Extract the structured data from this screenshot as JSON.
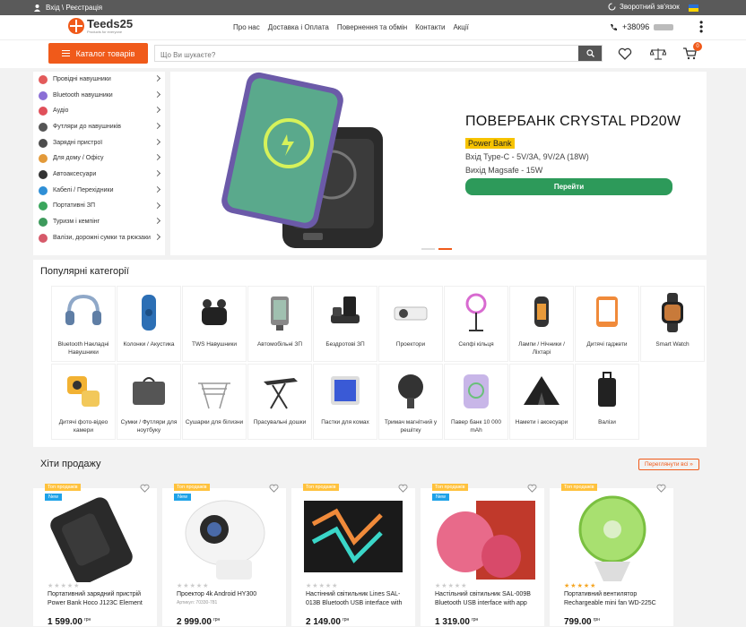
{
  "topbar": {
    "login": "Вхід \\ Реєстрація",
    "callback": "Зворотний зв'язок"
  },
  "header": {
    "logo": "Teeds25",
    "logo_sub": "Products for everyone",
    "nav": [
      "Про нас",
      "Доставка і Оплата",
      "Повернення та обмін",
      "Контакти",
      "Акції"
    ],
    "phone": "+38096"
  },
  "search": {
    "catalog_label": "Каталог товарів",
    "placeholder": "Що Ви шукаєте?",
    "cart_count": "0"
  },
  "sidebar": {
    "items": [
      {
        "label": "Провідні навушники",
        "color": "#e35b5b"
      },
      {
        "label": "Bluetooth навушники",
        "color": "#8b6fd6"
      },
      {
        "label": "Аудіо",
        "color": "#e0505a"
      },
      {
        "label": "Футляри до навушників",
        "color": "#555555"
      },
      {
        "label": "Зарядні пристрої",
        "color": "#4d4d4d"
      },
      {
        "label": "Для дому / Офісу",
        "color": "#e39a3a"
      },
      {
        "label": "Автоаксесуари",
        "color": "#333333"
      },
      {
        "label": "Кабелі / Перехідники",
        "color": "#2f8fd6"
      },
      {
        "label": "Портативні ЗП",
        "color": "#3aa65c"
      },
      {
        "label": "Туризм і кемпінг",
        "color": "#3d9a5c"
      },
      {
        "label": "Валізи, дорожні сумки та рюкзаки",
        "color": "#d65a6a"
      }
    ]
  },
  "banner": {
    "title": "ПОВЕРБАНК CRYSTAL PD20W",
    "tag": "Power Bank",
    "line1": "Вхід Type-C - 5V/3A, 9V/2A (18W)",
    "line2": "Вихід Magsafe - 15W",
    "button": "Перейти"
  },
  "categories": {
    "title": "Популярні категорії",
    "items": [
      {
        "label": "Bluetooth Накладні Навушники",
        "icon": "headphones-icon"
      },
      {
        "label": "Колонки / Акустика",
        "icon": "speaker-icon"
      },
      {
        "label": "TWS Навушники",
        "icon": "earbuds-icon"
      },
      {
        "label": "Автомобільні ЗП",
        "icon": "car-charger-icon"
      },
      {
        "label": "Бездротові ЗП",
        "icon": "wireless-charger-icon"
      },
      {
        "label": "Проектори",
        "icon": "projector-icon"
      },
      {
        "label": "Селфі кільця",
        "icon": "ring-light-icon"
      },
      {
        "label": "Лампи / Нічники / Ліхтарі",
        "icon": "lamp-icon"
      },
      {
        "label": "Дитячі гаджети",
        "icon": "kids-gadget-icon"
      },
      {
        "label": "Smart Watch",
        "icon": "watch-icon"
      },
      {
        "label": "Дитячі фото-відео камери",
        "icon": "kids-camera-icon"
      },
      {
        "label": "Сумки / Футляри для ноутбуку",
        "icon": "laptop-bag-icon"
      },
      {
        "label": "Сушарки для білизни",
        "icon": "dryer-rack-icon"
      },
      {
        "label": "Прасувальні дошки",
        "icon": "ironing-board-icon"
      },
      {
        "label": "Пастки для комах",
        "icon": "insect-trap-icon"
      },
      {
        "label": "Тримач магнітний у решітку",
        "icon": "magnetic-holder-icon"
      },
      {
        "label": "Павер банк 10 000 mAh",
        "icon": "powerbank-icon"
      },
      {
        "label": "Намети і аксесуари",
        "icon": "tent-icon"
      },
      {
        "label": "Валізи",
        "icon": "suitcase-icon"
      }
    ]
  },
  "hits": {
    "title": "Хіти продажу",
    "see_all": "Переглянути всі »",
    "tag_top": "Топ продажів",
    "tag_new": "New",
    "currency": "грн",
    "products": [
      {
        "name": "Портативний зарядний пристрій Power Bank Hoco J123C Element",
        "sku": "",
        "price": "1 599.00",
        "new": true,
        "rating": 0
      },
      {
        "name": "Проектор 4k Android HY300",
        "sku": "Артикул: 70330-781",
        "price": "2 999.00",
        "new": true,
        "rating": 0
      },
      {
        "name": "Настінний світильник Lines SAL-013B Bluetooth USB interface with",
        "sku": "",
        "price": "2 149.00",
        "new": false,
        "rating": 0
      },
      {
        "name": "Настільний світильник SAL-009B Bluetooth USB interface with app",
        "sku": "",
        "price": "1 319.00",
        "new": true,
        "rating": 0
      },
      {
        "name": "Портативний вентилятор Rechargeable mini fan WD-225C",
        "sku": "",
        "price": "799.00",
        "new": false,
        "rating": 5
      }
    ]
  }
}
